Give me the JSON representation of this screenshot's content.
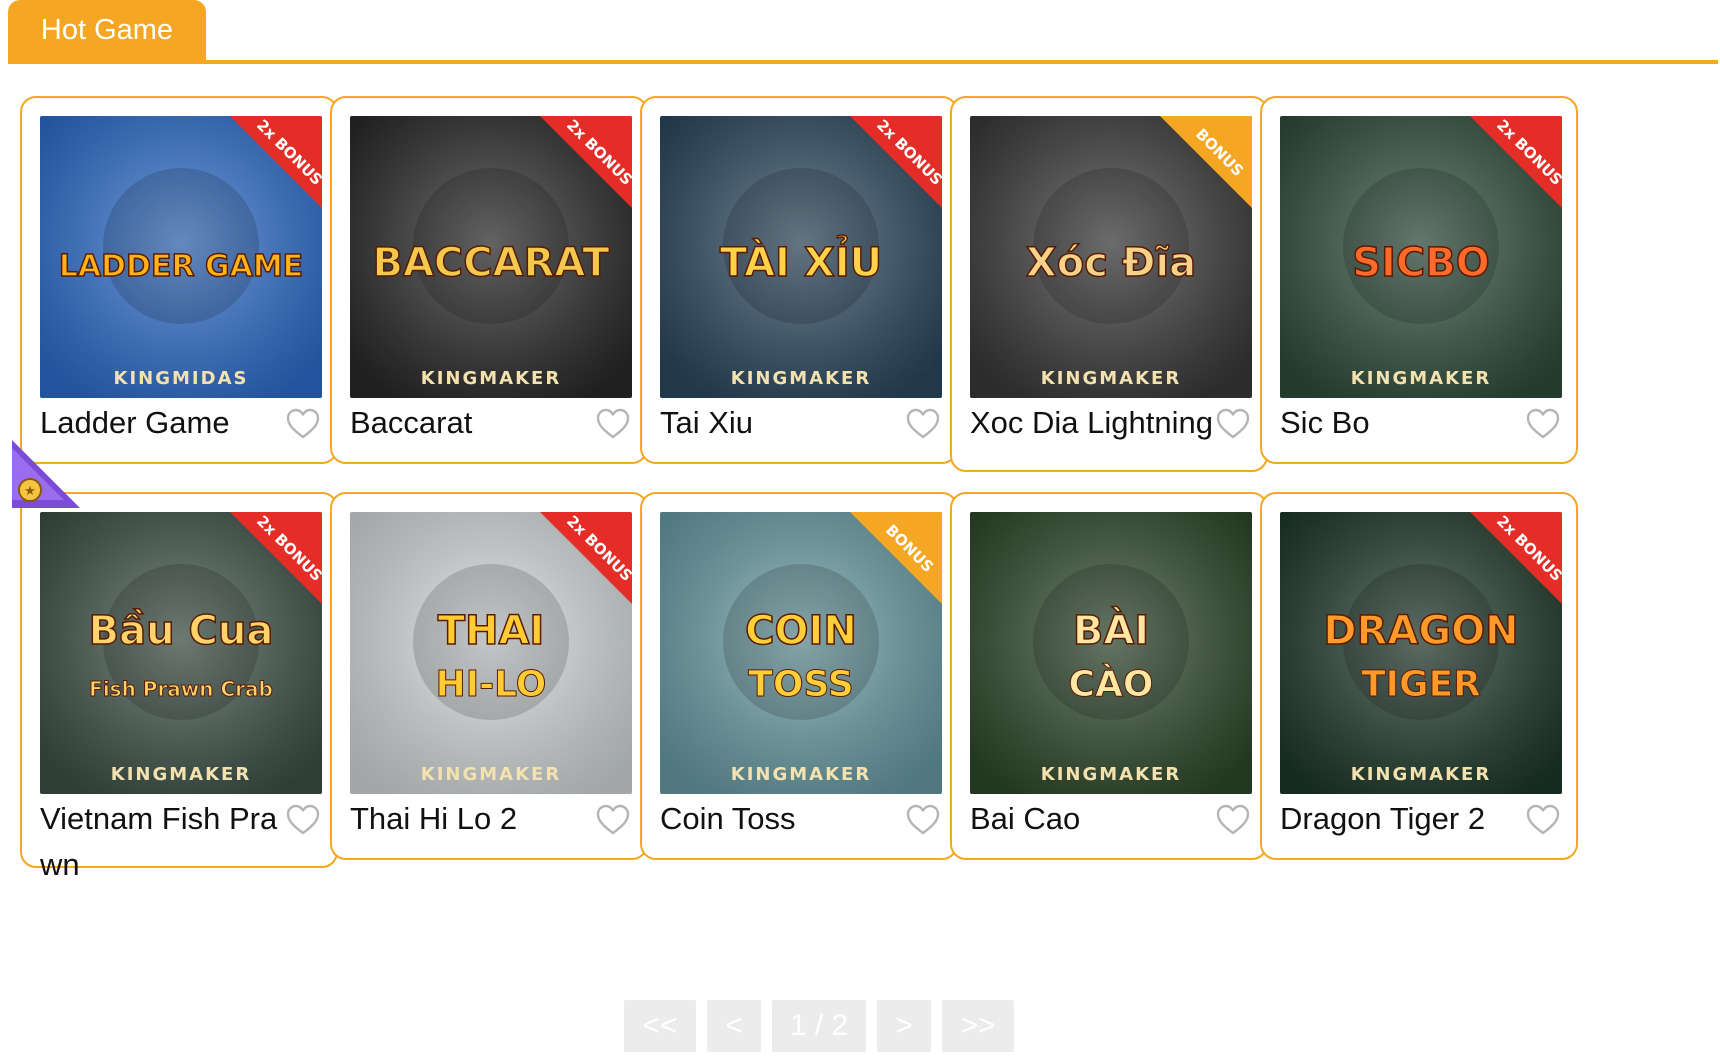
{
  "section": {
    "title": "Hot Game"
  },
  "colors": {
    "accent": "#f5a623",
    "pager_bg": "#ececec"
  },
  "games": [
    {
      "name": "Ladder Game",
      "art": "LADDER GAME",
      "provider": "KINGMIDAS",
      "badge": "2x BONUS",
      "bg": "#2e6fd0",
      "fg": "#ffb31a",
      "icon": "heart-outline-icon"
    },
    {
      "name": "Baccarat",
      "art": "BACCARAT",
      "provider": "KINGMAKER",
      "badge": "2x BONUS",
      "bg": "#2a2a2a",
      "fg": "#f2c94c",
      "icon": "heart-outline-icon"
    },
    {
      "name": "Tai Xiu",
      "art": "TÀI XỈU",
      "provider": "KINGMAKER",
      "badge": "2x BONUS",
      "bg": "#2c4a62",
      "fg": "#ffd24a",
      "icon": "heart-outline-icon"
    },
    {
      "name": "Xoc Dia Lightning",
      "art": "Xóc Đĩa",
      "provider": "KINGMAKER",
      "badge": "BONUS",
      "bg": "#3a3a3a",
      "fg": "#f4d28a",
      "icon": "heart-outline-icon"
    },
    {
      "name": "Sic Bo",
      "art": "SICBO",
      "provider": "KINGMAKER",
      "badge": "2x BONUS",
      "bg": "#2f4f3c",
      "fg": "#ff6a2a",
      "icon": "heart-outline-icon"
    },
    {
      "name": "Vietnam Fish Prawn",
      "art": "Bầu Cua",
      "art2": "Fish Prawn Crab",
      "provider": "KINGMAKER",
      "badge": "2x BONUS",
      "bg": "#3d5348",
      "fg": "#ffd36b",
      "icon": "heart-outline-icon"
    },
    {
      "name": "Thai Hi Lo 2",
      "art": "THAI",
      "art2": "HI-LO",
      "provider": "KINGMAKER",
      "badge": "2x BONUS",
      "bg": "#d9dfe0",
      "fg": "#ffcc33",
      "icon": "heart-outline-icon"
    },
    {
      "name": "Coin Toss",
      "art": "COIN",
      "art2": "TOSS",
      "provider": "KINGMAKER",
      "badge": "BONUS",
      "bg": "#6aa0a8",
      "fg": "#ffcf3a",
      "icon": "heart-outline-icon"
    },
    {
      "name": "Bai Cao",
      "art": "BÀI",
      "art2": "CÀO",
      "provider": "KINGMAKER",
      "badge": "",
      "bg": "#2f4a2c",
      "fg": "#ffe7a3",
      "icon": "heart-outline-icon"
    },
    {
      "name": "Dragon Tiger 2",
      "art": "DRAGON",
      "art2": "TIGER",
      "provider": "KINGMAKER",
      "badge": "2x BONUS",
      "bg": "#1f3a2c",
      "fg": "#ff9a2a",
      "icon": "heart-outline-icon"
    }
  ],
  "pager": {
    "first": "<<",
    "prev": "<",
    "page": "1 / 2",
    "next": ">",
    "last": ">>"
  }
}
